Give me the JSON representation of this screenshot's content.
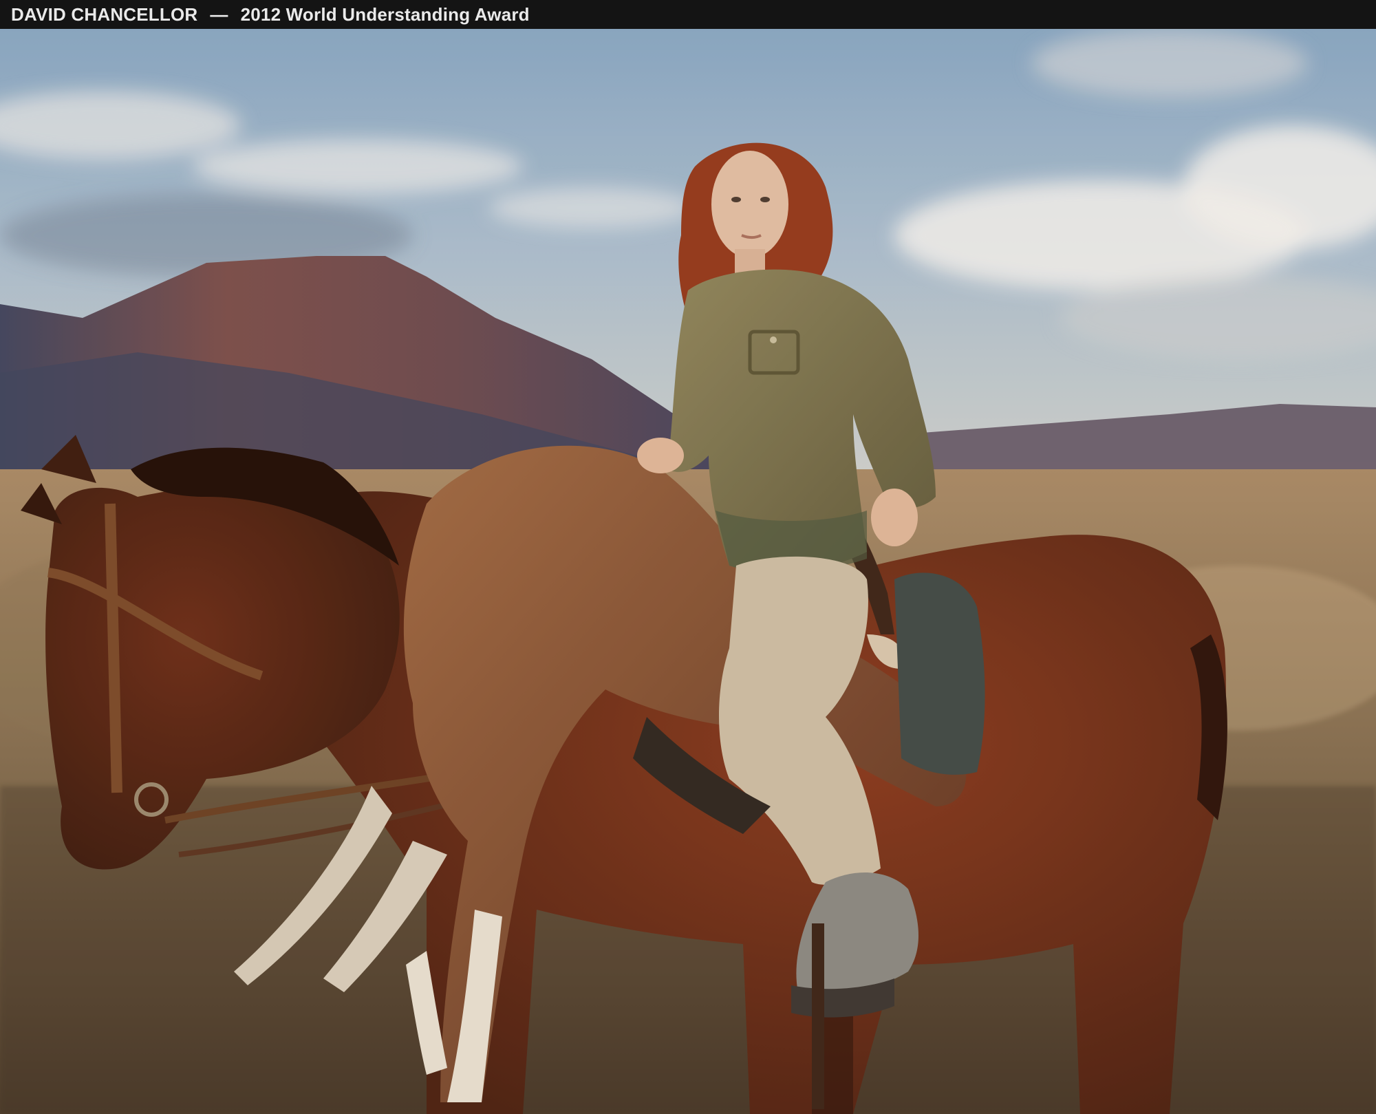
{
  "caption": {
    "photographer": "DAVID CHANCELLOR",
    "separator": "—",
    "award": "2012 World Understanding Award"
  },
  "photo": {
    "palette": {
      "sky_top": "#8fb0cc",
      "sky_low": "#c9d3d6",
      "mountain": "#6e4a4a",
      "mountain_shadow": "#3c4560",
      "field": "#9c8360",
      "horse": "#6a2e1a",
      "antelope": "#7a4a30",
      "shirt": "#7d7650",
      "hair": "#9a3a1c",
      "trousers": "#cfc2aa"
    }
  }
}
